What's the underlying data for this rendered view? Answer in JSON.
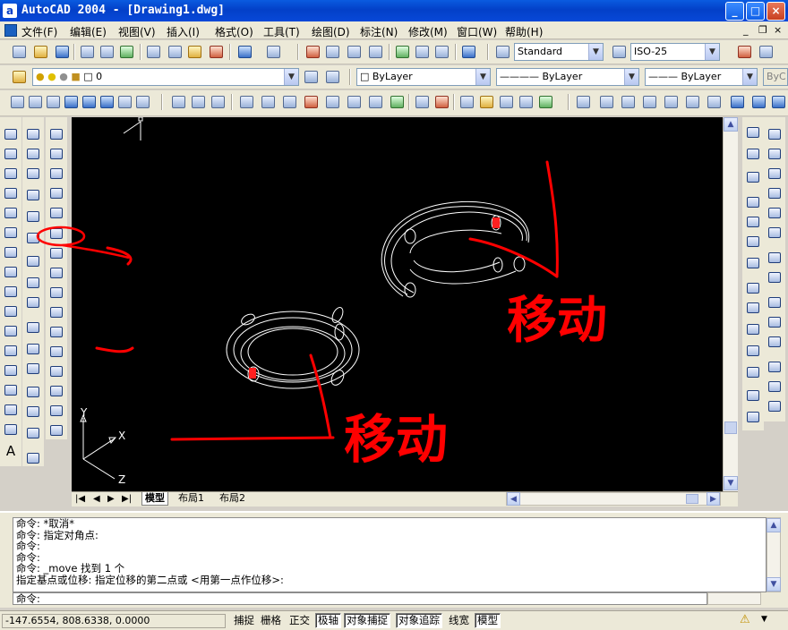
{
  "app": {
    "title": "AutoCAD 2004 - [Drawing1.dwg]",
    "icon": "autocad-app-icon"
  },
  "window_controls": {
    "minimize": "_",
    "maximize": "□",
    "close": "×"
  },
  "menu": {
    "items": [
      "文件(F)",
      "编辑(E)",
      "视图(V)",
      "插入(I)",
      "格式(O)",
      "工具(T)",
      "绘图(D)",
      "标注(N)",
      "修改(M)",
      "窗口(W)",
      "帮助(H)"
    ],
    "doc_controls": [
      "_",
      "❐",
      "×"
    ]
  },
  "standard_toolbar": {
    "text_style": "Standard",
    "dim_style": "ISO-25"
  },
  "layers_toolbar": {
    "current_layer": "0"
  },
  "properties_toolbar": {
    "color": "ByLayer",
    "linetype": "ByLayer",
    "lineweight": "ByLayer",
    "plotstyle": "ByC"
  },
  "ucs": {
    "x_label": "X",
    "y_label": "Y",
    "z_label": "Z"
  },
  "annotations": {
    "move_label_1": "移动",
    "move_label_2": "移动",
    "colors": {
      "ink": "#ff0000",
      "grip": "#ff2020"
    }
  },
  "layout_tabs": {
    "nav": [
      "|◀",
      "◀",
      "▶",
      "▶|"
    ],
    "tabs": [
      "模型",
      "布局1",
      "布局2"
    ],
    "active": "模型"
  },
  "command_window": {
    "history": [
      "命令: *取消*",
      "命令: 指定对角点:",
      "命令:",
      "命令:",
      "命令: _move 找到 1 个",
      "指定基点或位移: 指定位移的第二点或 <用第一点作位移>:"
    ],
    "prompt": "命令:"
  },
  "status_bar": {
    "coordinates": "-147.6554, 808.6338, 0.0000",
    "toggles": [
      {
        "label": "捕捉",
        "on": false
      },
      {
        "label": "栅格",
        "on": false
      },
      {
        "label": "正交",
        "on": false
      },
      {
        "label": "极轴",
        "on": true
      },
      {
        "label": "对象捕捉",
        "on": true
      },
      {
        "label": "对象追踪",
        "on": true
      },
      {
        "label": "线宽",
        "on": false
      },
      {
        "label": "模型",
        "on": true
      }
    ]
  },
  "colors": {
    "titlebar": "#0a50d8",
    "canvas_bg": "#000000",
    "entity": "#ffffff"
  }
}
